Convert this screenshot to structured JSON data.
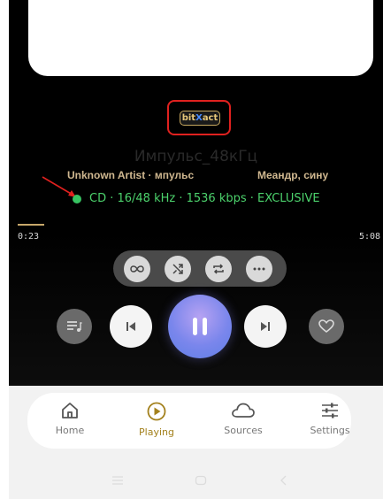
{
  "badge": "bitXact",
  "track": {
    "title": "Импульс_48кГц",
    "artist_line": "Unknown Artist · мпульс",
    "album": "Меандр, сину",
    "format": "CD · 16/48 kHz · 1536 kbps · EXCLUSIVE",
    "progress": 0.07
  },
  "time": {
    "elapsed": "0:23",
    "duration": "5:08"
  },
  "modes": [
    "loop-icon",
    "shuffle-icon",
    "repeat-icon",
    "more-icon"
  ],
  "controls": [
    "queue-icon",
    "previous-icon",
    "pause-icon",
    "next-icon",
    "heart-icon"
  ],
  "nav": [
    {
      "label": "Home",
      "icon": "home-icon"
    },
    {
      "label": "Playing",
      "icon": "play-circle-icon",
      "active": true
    },
    {
      "label": "Sources",
      "icon": "cloud-icon"
    },
    {
      "label": "Settings",
      "icon": "sliders-icon"
    }
  ],
  "colors": {
    "accent": "#a3811d",
    "format": "#4cd26c",
    "annotation": "#e0211f"
  }
}
